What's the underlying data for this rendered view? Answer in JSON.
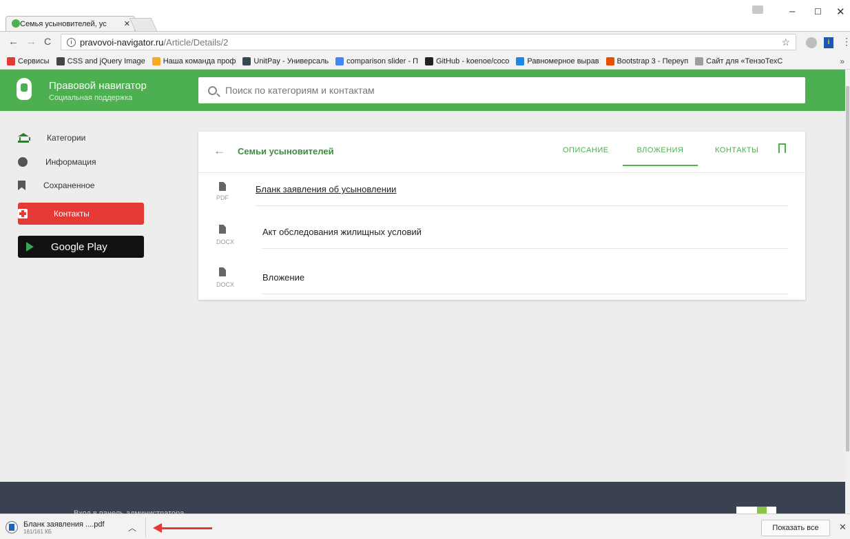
{
  "browser": {
    "tab_title": "Семья усыновителей, ус",
    "tab_close": "✕",
    "url_host": "pravovoi-navigator.ru",
    "url_path": "/Article/Details/2",
    "bookmarks": [
      {
        "label": "Сервисы",
        "color": "#e53935"
      },
      {
        "label": "CSS and jQuery Image",
        "color": "#444444"
      },
      {
        "label": "Наша команда проф",
        "color": "#f9a825"
      },
      {
        "label": "UnitPay - Универсаль",
        "color": "#37474f"
      },
      {
        "label": "comparison slider - П",
        "color": "#4285f4"
      },
      {
        "label": "GitHub - koenoe/coco",
        "color": "#222222"
      },
      {
        "label": "Равномерное вырав",
        "color": "#1e88e5"
      },
      {
        "label": "Bootstrap 3 - Переуп",
        "color": "#e65100"
      },
      {
        "label": "Сайт для «ТензоТехС",
        "color": "#9e9e9e"
      }
    ],
    "bookmarks_more": "»"
  },
  "header": {
    "brand_title": "Правовой навигатор",
    "brand_subtitle": "Социальная поддержка",
    "search_placeholder": "Поиск по категориям и контактам"
  },
  "sidebar": {
    "items": [
      {
        "label": "Категории",
        "icon": "bank-icon"
      },
      {
        "label": "Информация",
        "icon": "info-icon"
      },
      {
        "label": "Сохраненное",
        "icon": "bookmark-icon"
      }
    ],
    "contacts_label": "Контакты",
    "gplay_label": "Google Play"
  },
  "card": {
    "title": "Семьи усыновителей",
    "tabs": [
      "ОПИСАНИЕ",
      "ВЛОЖЕНИЯ",
      "КОНТАКТЫ"
    ],
    "active_tab": "ВЛОЖЕНИЯ",
    "attachments": [
      {
        "type": "PDF",
        "name": "Бланк заявления об усыновлении"
      },
      {
        "type": "DOCX",
        "name": "Акт обследования жилищных условий"
      },
      {
        "type": "DOCX",
        "name": "Вложение"
      }
    ]
  },
  "footer": {
    "admin_text": "Вход в панель администратора"
  },
  "download_bar": {
    "file_name": "Бланк заявления ....pdf",
    "file_size": "161/161 КБ",
    "show_all": "Показать все",
    "close": "✕"
  },
  "colors": {
    "brand_green": "#4caf50",
    "contacts_red": "#e53935",
    "footer_dark": "#3a4252"
  }
}
